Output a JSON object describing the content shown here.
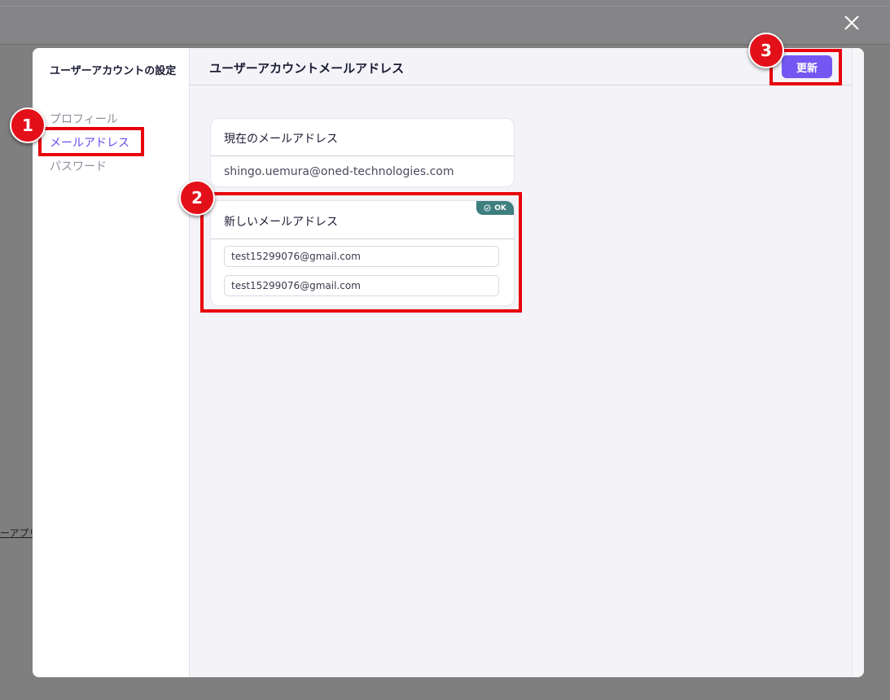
{
  "background": {
    "link_text": "ーアプリ"
  },
  "sidebar": {
    "title": "ユーザーアカウントの設定",
    "items": [
      {
        "label": "プロフィール",
        "active": false
      },
      {
        "label": "メールアドレス",
        "active": true
      },
      {
        "label": "パスワード",
        "active": false
      }
    ]
  },
  "header": {
    "title": "ユーザーアカウントメールアドレス",
    "update_label": "更新"
  },
  "current_email": {
    "label": "現在のメールアドレス",
    "value": "shingo.uemura@oned-technologies.com"
  },
  "new_email": {
    "label": "新しいメールアドレス",
    "badge": "OK",
    "value": "test15299076@gmail.com",
    "confirm_value": "test15299076@gmail.com"
  },
  "annotations": {
    "step1": "1",
    "step2": "2",
    "step3": "3"
  },
  "colors": {
    "accent": "#7457f2",
    "active_nav": "#6a4bf0",
    "ok_badge": "#3e7f7e",
    "highlight": "#e8000b"
  }
}
